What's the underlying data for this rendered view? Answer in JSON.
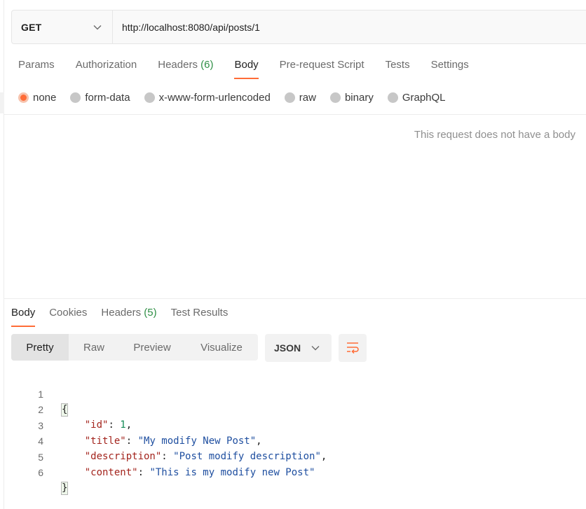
{
  "request": {
    "method": "GET",
    "url": "http://localhost:8080/api/posts/1",
    "tabs": [
      {
        "label": "Params"
      },
      {
        "label": "Authorization"
      },
      {
        "label": "Headers",
        "count": "(6)"
      },
      {
        "label": "Body"
      },
      {
        "label": "Pre-request Script"
      },
      {
        "label": "Tests"
      },
      {
        "label": "Settings"
      }
    ],
    "active_tab": "Body",
    "body_modes": [
      "none",
      "form-data",
      "x-www-form-urlencoded",
      "raw",
      "binary",
      "GraphQL"
    ],
    "selected_body_mode": "none",
    "no_body_message": "This request does not have a body"
  },
  "response": {
    "tabs": [
      {
        "label": "Body"
      },
      {
        "label": "Cookies"
      },
      {
        "label": "Headers",
        "count": "(5)"
      },
      {
        "label": "Test Results"
      }
    ],
    "active_tab": "Body",
    "views": [
      "Pretty",
      "Raw",
      "Preview",
      "Visualize"
    ],
    "active_view": "Pretty",
    "format": "JSON",
    "line_numbers": [
      "1",
      "2",
      "3",
      "4",
      "5",
      "6"
    ],
    "code": {
      "open_brace": "{",
      "close_brace": "}",
      "fields": [
        {
          "key": "\"id\"",
          "value": "1",
          "type": "number",
          "comma": ","
        },
        {
          "key": "\"title\"",
          "value": "\"My modify New Post\"",
          "type": "string",
          "comma": ","
        },
        {
          "key": "\"description\"",
          "value": "\"Post modify description\"",
          "type": "string",
          "comma": ","
        },
        {
          "key": "\"content\"",
          "value": "\"This is my modify new Post\"",
          "type": "string",
          "comma": ""
        }
      ]
    }
  },
  "colors": {
    "accent": "#ff6c37",
    "count": "#2f8f46",
    "json_key": "#a3241d",
    "json_string": "#1f4fa0",
    "json_number": "#148a56"
  },
  "icons": {
    "method_dropdown": "chevron-down-icon",
    "format_dropdown": "chevron-down-icon",
    "wrap": "wrap-lines-icon"
  }
}
